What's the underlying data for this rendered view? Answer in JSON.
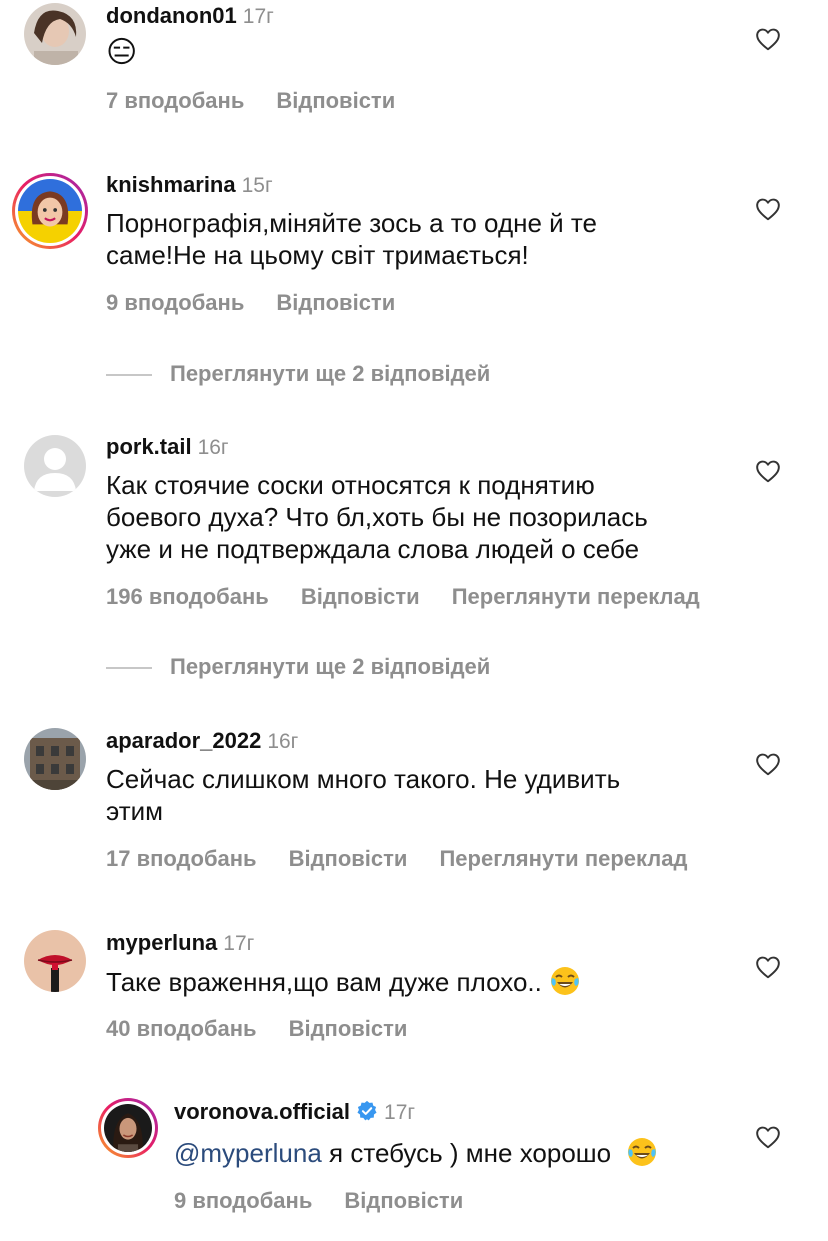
{
  "comments": [
    {
      "username": "dondanon01",
      "time": "17г",
      "text": "😑",
      "likes": "7 вподобань",
      "reply": "Відповісти"
    },
    {
      "username": "knishmarina",
      "time": "15г",
      "text_line1": "Порнографія,міняйте зось а то одне й те",
      "text_line2": "саме!Не на цьому світ тримається!",
      "likes": "9 вподобань",
      "reply": "Відповісти",
      "more_replies": "Переглянути ще 2 відповідей"
    },
    {
      "username": "pork.tail",
      "time": "16г",
      "text_line1": "Как стоячие соски относятся к поднятию",
      "text_line2": "боевого духа? Что бл,хоть бы не позорилась",
      "text_line3": "уже и не подтверждала слова людей о себе",
      "likes": "196 вподобань",
      "reply": "Відповісти",
      "translate": "Переглянути переклад",
      "more_replies": "Переглянути ще 2 відповідей"
    },
    {
      "username": "aparador_2022",
      "time": "16г",
      "text_line1": "Сейчас слишком много такого. Не удивить",
      "text_line2": "этим",
      "likes": "17 вподобань",
      "reply": "Відповісти",
      "translate": "Переглянути переклад"
    },
    {
      "username": "myperluna",
      "time": "17г",
      "text": "Таке враження,що вам дуже плохо..",
      "likes": "40 вподобань",
      "reply": "Відповісти"
    },
    {
      "username": "voronova.official",
      "time": "17г",
      "mention": "@myperluna",
      "text": " я стебусь ) мне хорошо ",
      "likes": "9 вподобань",
      "reply": "Відповісти"
    }
  ],
  "icons": {
    "like": "heart-outline-icon",
    "verified": "verified-badge-icon",
    "laugh": "tears-of-joy-emoji"
  },
  "colors": {
    "text": "#111111",
    "muted": "#8e8e8e",
    "mention": "#2b4b7c",
    "verified": "#3897f0"
  }
}
